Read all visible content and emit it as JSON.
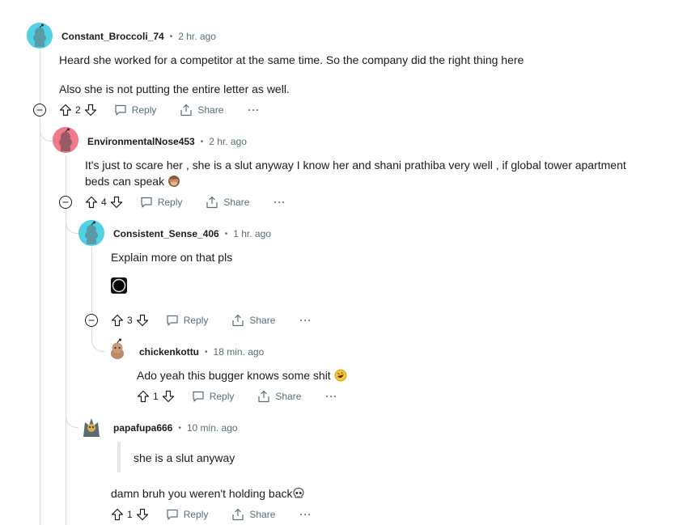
{
  "comments": [
    {
      "author": "Constant_Broccoli_74",
      "time": "2 hr. ago",
      "lines": [
        "Heard she worked for a competitor at the same time. So the company did the right thing here",
        "Also she is not putting the entire letter as well."
      ],
      "score": "2",
      "reply": "Reply",
      "share": "Share"
    },
    {
      "author": "EnvironmentalNose453",
      "time": "2 hr. ago",
      "line1": "It's just to scare her , she is a slut anyway I know her and shani prathiba very well , if global tower apartment",
      "line2": "beds can speak",
      "score": "4",
      "reply": "Reply",
      "share": "Share",
      "emoji": "see-no-evil-monkey"
    },
    {
      "author": "Consistent_Sense_406",
      "time": "1 hr. ago",
      "line1": "Explain more on that pls",
      "score": "3",
      "reply": "Reply",
      "share": "Share"
    },
    {
      "author": "chickenkottu",
      "time": "18 min. ago",
      "line1": "Ado yeah this bugger knows some shit",
      "score": "1",
      "reply": "Reply",
      "share": "Share",
      "emoji": "rolling-on-floor-laughing"
    },
    {
      "author": "papafupa666",
      "time": "10 min. ago",
      "quote": "she is a slut anyway",
      "line1": "damn bruh you weren't holding back",
      "score": "1",
      "reply": "Reply",
      "share": "Share",
      "emoji": "skull"
    }
  ],
  "colors": {
    "accent_teal": "#4fd1e6",
    "accent_pink": "#f07a8a",
    "text_secondary": "#576f76",
    "thread_line": "#d6dadc"
  },
  "separator": "•"
}
